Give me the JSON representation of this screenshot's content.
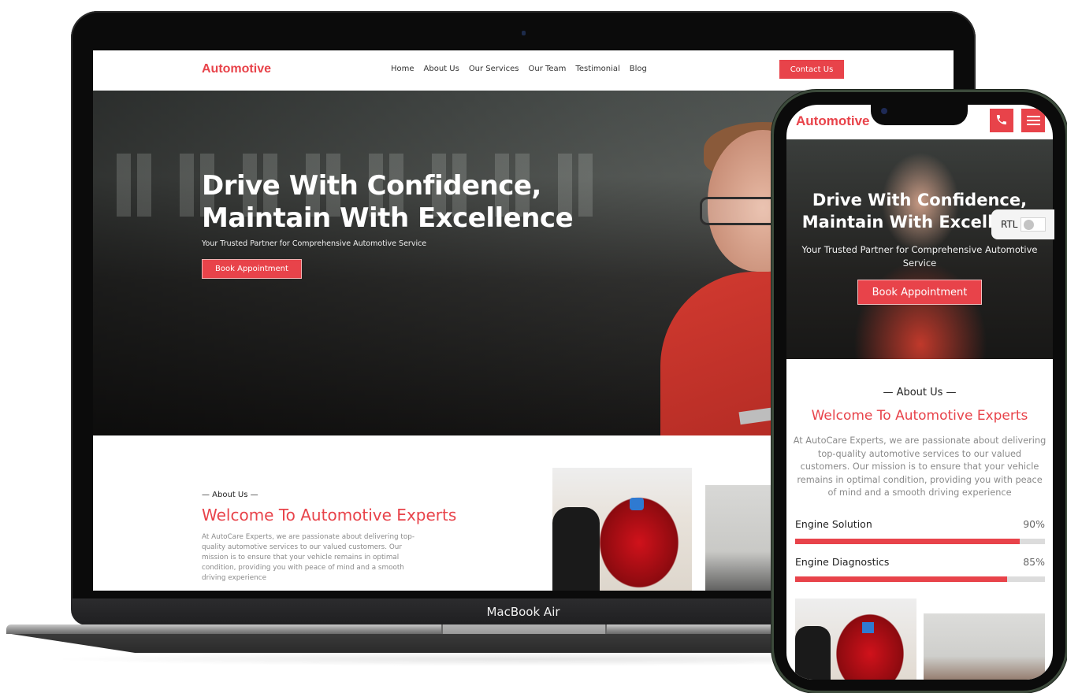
{
  "device_labels": {
    "laptop_brand": "MacBook Air"
  },
  "colors": {
    "accent": "#e8434a",
    "text_dark": "#222222",
    "text_muted": "#8a8a8a"
  },
  "desktop": {
    "header": {
      "logo": "Automotive",
      "nav": [
        "Home",
        "About Us",
        "Our Services",
        "Our Team",
        "Testimonial",
        "Blog"
      ],
      "contact_button": "Contact Us"
    },
    "hero": {
      "title_line1": "Drive With Confidence,",
      "title_line2": "Maintain With Excellence",
      "subtitle": "Your Trusted Partner for Comprehensive Automotive Service",
      "cta": "Book Appointment"
    },
    "about": {
      "label": "— About Us —",
      "title": "Welcome To Automotive Experts",
      "text": "At AutoCare Experts, we are passionate about delivering top-quality automotive services to our valued customers. Our mission is to ensure that your vehicle remains in optimal condition, providing you with peace of mind and a smooth driving experience"
    }
  },
  "mobile": {
    "header": {
      "logo": "Automotive",
      "call_icon": "phone-icon",
      "menu_icon": "hamburger-icon"
    },
    "hero": {
      "title_line1": "Drive With Confidence,",
      "title_line2": "Maintain With Excellence",
      "subtitle": "Your Trusted Partner for Comprehensive Automotive Service",
      "cta": "Book Appointment"
    },
    "rtl_toggle": {
      "label": "RTL",
      "enabled": false
    },
    "about": {
      "label": "— About Us —",
      "title": "Welcome To Automotive Experts",
      "text": "At AutoCare Experts, we are passionate about delivering top-quality automotive services to our valued customers. Our mission is to ensure that your vehicle remains in optimal condition, providing you with peace of mind and a smooth driving experience"
    },
    "skills": [
      {
        "name": "Engine Solution",
        "percent_label": "90%",
        "value": 90
      },
      {
        "name": "Engine Diagnostics",
        "percent_label": "85%",
        "value": 85
      }
    ]
  }
}
